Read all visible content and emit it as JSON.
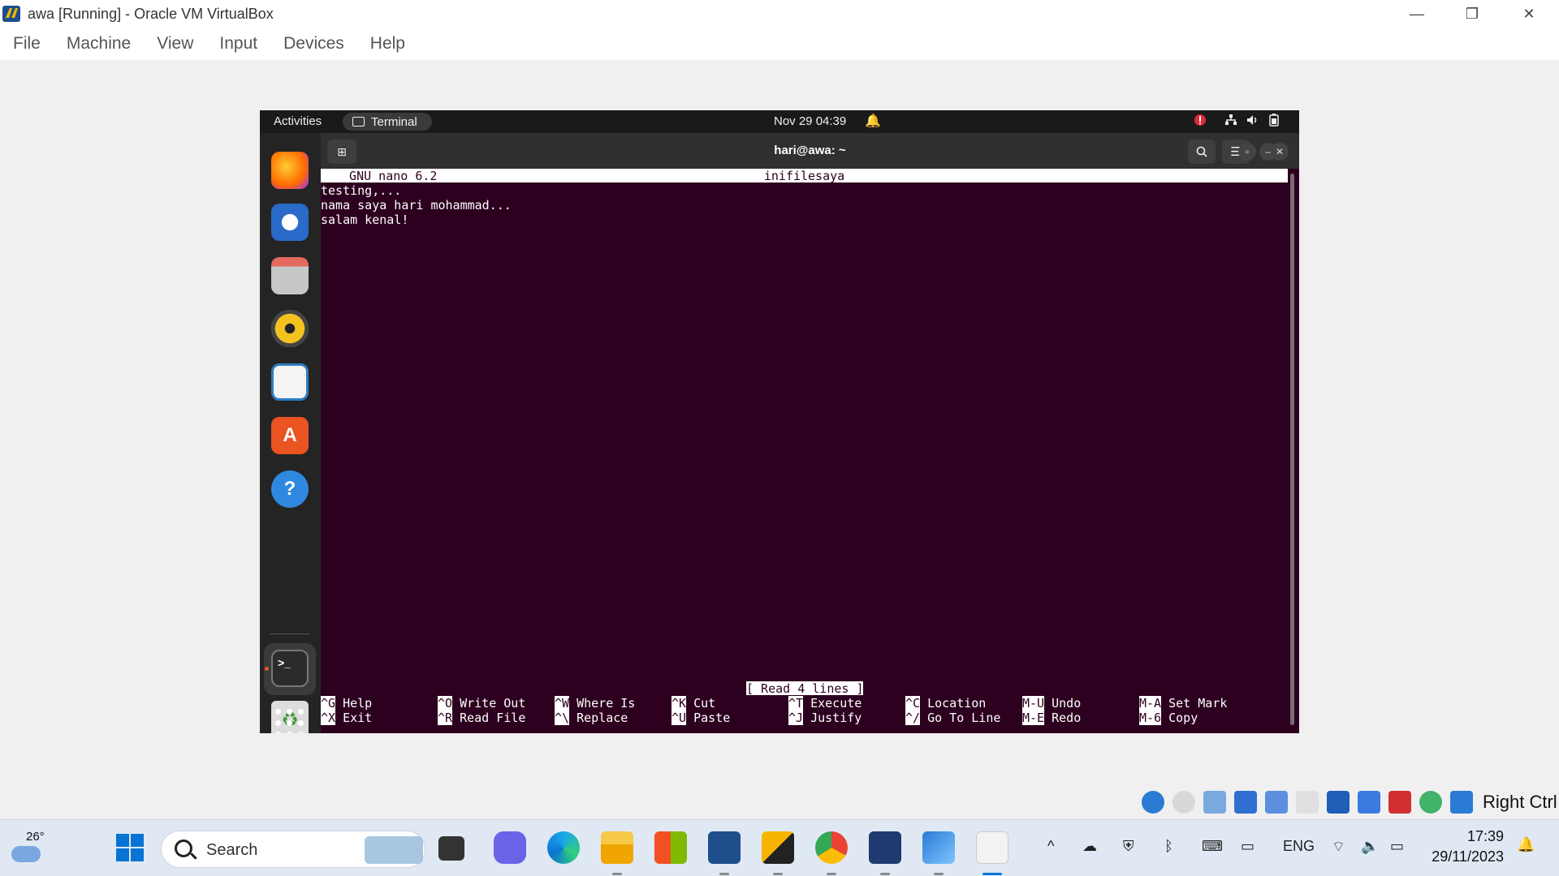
{
  "window": {
    "title": "awa [Running] - Oracle VM VirtualBox",
    "minimize": "—",
    "restore": "❐",
    "close": "✕"
  },
  "menu": [
    "File",
    "Machine",
    "View",
    "Input",
    "Devices",
    "Help"
  ],
  "ubuntu": {
    "activities": "Activities",
    "active_app": "Terminal",
    "clock": "Nov 29  04:39"
  },
  "terminal": {
    "title": "hari@awa: ~"
  },
  "nano": {
    "version": "  GNU nano 6.2",
    "filename": "inifilesaya",
    "lines": [
      "testing,...",
      "nama saya hari mohammad...",
      "salam kenal!"
    ],
    "status": "[ Read 4 lines ]",
    "shortcuts": [
      {
        "key": "^G",
        "label": "Help"
      },
      {
        "key": "^X",
        "label": "Exit"
      },
      {
        "key": "^O",
        "label": "Write Out"
      },
      {
        "key": "^R",
        "label": "Read File"
      },
      {
        "key": "^W",
        "label": "Where Is"
      },
      {
        "key": "^\\",
        "label": "Replace"
      },
      {
        "key": "^K",
        "label": "Cut"
      },
      {
        "key": "^U",
        "label": "Paste"
      },
      {
        "key": "^T",
        "label": "Execute"
      },
      {
        "key": "^J",
        "label": "Justify"
      },
      {
        "key": "^C",
        "label": "Location"
      },
      {
        "key": "^/",
        "label": "Go To Line"
      },
      {
        "key": "M-U",
        "label": "Undo"
      },
      {
        "key": "M-E",
        "label": "Redo"
      },
      {
        "key": "M-A",
        "label": "Set Mark"
      },
      {
        "key": "M-6",
        "label": "Copy"
      }
    ]
  },
  "vbox_status": {
    "host_key": "Right Ctrl"
  },
  "taskbar": {
    "temperature": "26°",
    "search_placeholder": "Search",
    "language": "ENG",
    "time": "17:39",
    "date": "29/11/2023"
  },
  "colors": {
    "terminal_bg": "#2c001e",
    "ubuntu_accent": "#e95420"
  }
}
